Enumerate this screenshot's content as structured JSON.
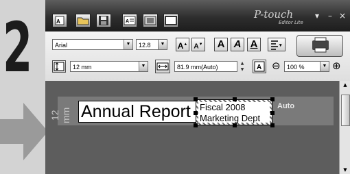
{
  "step": {
    "number": "2"
  },
  "window": {
    "logo": "P-touch",
    "logo_sub": "Editor Lite",
    "controls": {
      "dropdown": "▾",
      "minimize": "–",
      "close": "×"
    }
  },
  "toolbar": {
    "font": {
      "value": "Arial"
    },
    "font_size": {
      "value": "12.8"
    },
    "buttons": {
      "grow": "A",
      "shrink": "A",
      "bold": "A",
      "italic": "A",
      "underline": "A"
    },
    "tape_width": {
      "value": "12 mm"
    },
    "label_length": {
      "value": "81.9 mm(Auto)"
    },
    "zoom": {
      "value": "100 %"
    },
    "zoom_out": "⊖",
    "zoom_in": "⊕"
  },
  "canvas": {
    "length_indicator": "12 mm",
    "text_main": "Annual Report",
    "selection_lines": [
      "Fiscal 2008",
      "Marketing Dept"
    ],
    "auto_label": "Auto"
  },
  "icons": [
    "new-label-icon",
    "open-folder-icon",
    "save-icon",
    "text-frame-icon",
    "image-icon",
    "frame-icon",
    "print-icon",
    "tape-width-icon",
    "label-length-icon",
    "fit-text-icon",
    "align-icon"
  ]
}
